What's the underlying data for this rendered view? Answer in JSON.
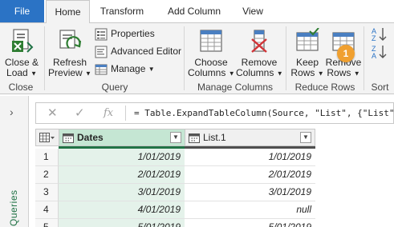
{
  "tabs": {
    "file": "File",
    "home": "Home",
    "transform": "Transform",
    "add_column": "Add Column",
    "view": "View"
  },
  "ribbon": {
    "close": {
      "btn_line1": "Close &",
      "btn_line2": "Load",
      "group": "Close"
    },
    "query": {
      "refresh_line1": "Refresh",
      "refresh_line2": "Preview",
      "properties": "Properties",
      "advanced_editor": "Advanced Editor",
      "manage": "Manage",
      "group": "Query"
    },
    "manage_columns": {
      "choose_line1": "Choose",
      "choose_line2": "Columns",
      "remove_line1": "Remove",
      "remove_line2": "Columns",
      "group": "Manage Columns"
    },
    "reduce_rows": {
      "keep_line1": "Keep",
      "keep_line2": "Rows",
      "remove_line1": "Remove",
      "remove_line2": "Rows",
      "group": "Reduce Rows"
    },
    "sort": {
      "group": "Sort"
    },
    "callout": "1"
  },
  "queries_pane": {
    "expand": "›",
    "label": "Queries"
  },
  "formula_bar": {
    "cancel": "✕",
    "confirm": "✓",
    "fx": "fx",
    "formula": "= Table.ExpandTableColumn(Source, \"List\", {\"List\""
  },
  "grid": {
    "columns": [
      "Dates",
      "List.1"
    ],
    "rows": [
      {
        "n": "1",
        "dates": "1/01/2019",
        "list": "1/01/2019"
      },
      {
        "n": "2",
        "dates": "2/01/2019",
        "list": "2/01/2019"
      },
      {
        "n": "3",
        "dates": "3/01/2019",
        "list": "3/01/2019"
      },
      {
        "n": "4",
        "dates": "4/01/2019",
        "list": "null"
      },
      {
        "n": "5",
        "dates": "5/01/2019",
        "list": "5/01/2019"
      }
    ]
  },
  "colors": {
    "file_tab": "#2b73c5",
    "accent_green": "#217346",
    "dates_header": "#c5e6d3",
    "dates_cells": "#e4f2ea",
    "callout": "#f0a030"
  }
}
